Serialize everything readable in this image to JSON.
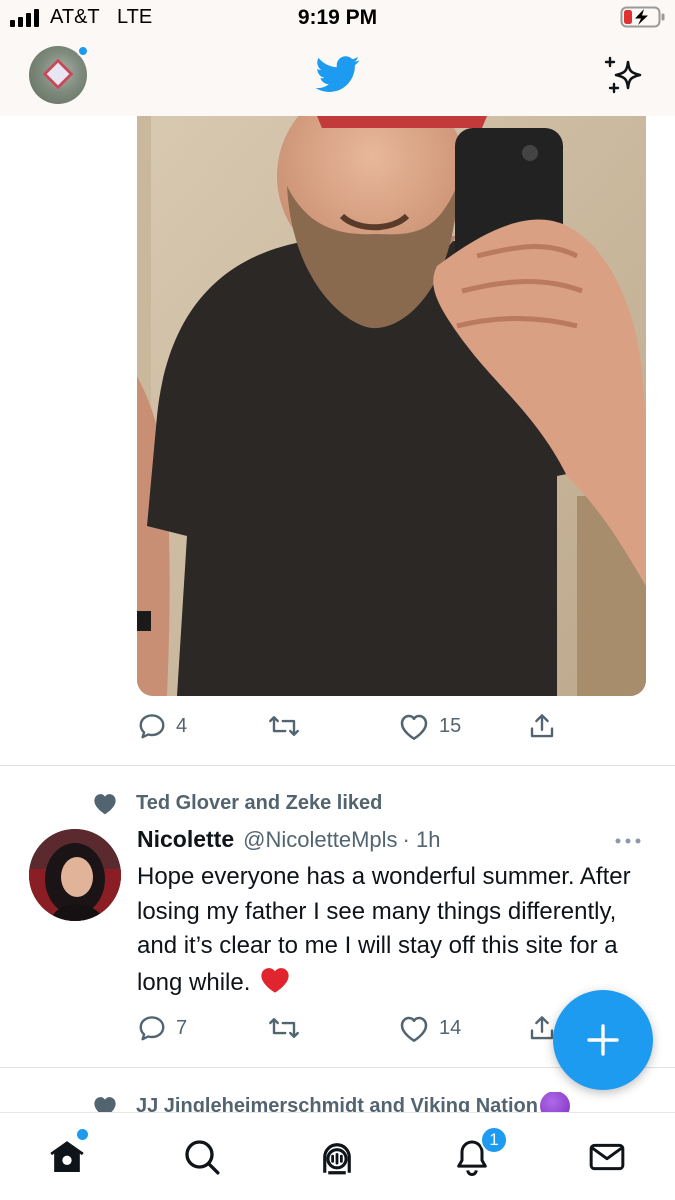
{
  "status_bar": {
    "carrier": "AT&T",
    "network": "LTE",
    "time": "9:19 PM"
  },
  "header": {
    "logo_icon": "twitter-bird-icon",
    "sparkle_icon": "sparkle-icon",
    "avatar_has_notification": true
  },
  "tweets": [
    {
      "media": "mirror-selfie-photo",
      "actions": {
        "reply_count": "4",
        "retweet_count": "",
        "like_count": "15"
      }
    },
    {
      "social_context": "Ted Glover and Zeke liked",
      "name": "Nicolette",
      "handle": "@NicoletteMpls",
      "time": "· 1h",
      "body": "Hope everyone has a wonderful summer. After losing my father I see many things differently, and it’s clear to me I will stay off this site for a long while.",
      "emoji": "❤️",
      "actions": {
        "reply_count": "7",
        "retweet_count": "",
        "like_count": "14"
      }
    },
    {
      "social_context": "JJ Jingleheimerschmidt and Viking Nation"
    }
  ],
  "fab": {
    "icon": "plus-icon",
    "color": "#1d9bf0"
  },
  "tab_bar": {
    "items": [
      "home-icon",
      "search-icon",
      "spaces-icon",
      "notifications-icon",
      "messages-icon"
    ],
    "notification_badge": "1"
  },
  "colors": {
    "accent": "#1d9bf0",
    "secondary_text": "#536471",
    "heart_emoji": "#e0252e"
  }
}
